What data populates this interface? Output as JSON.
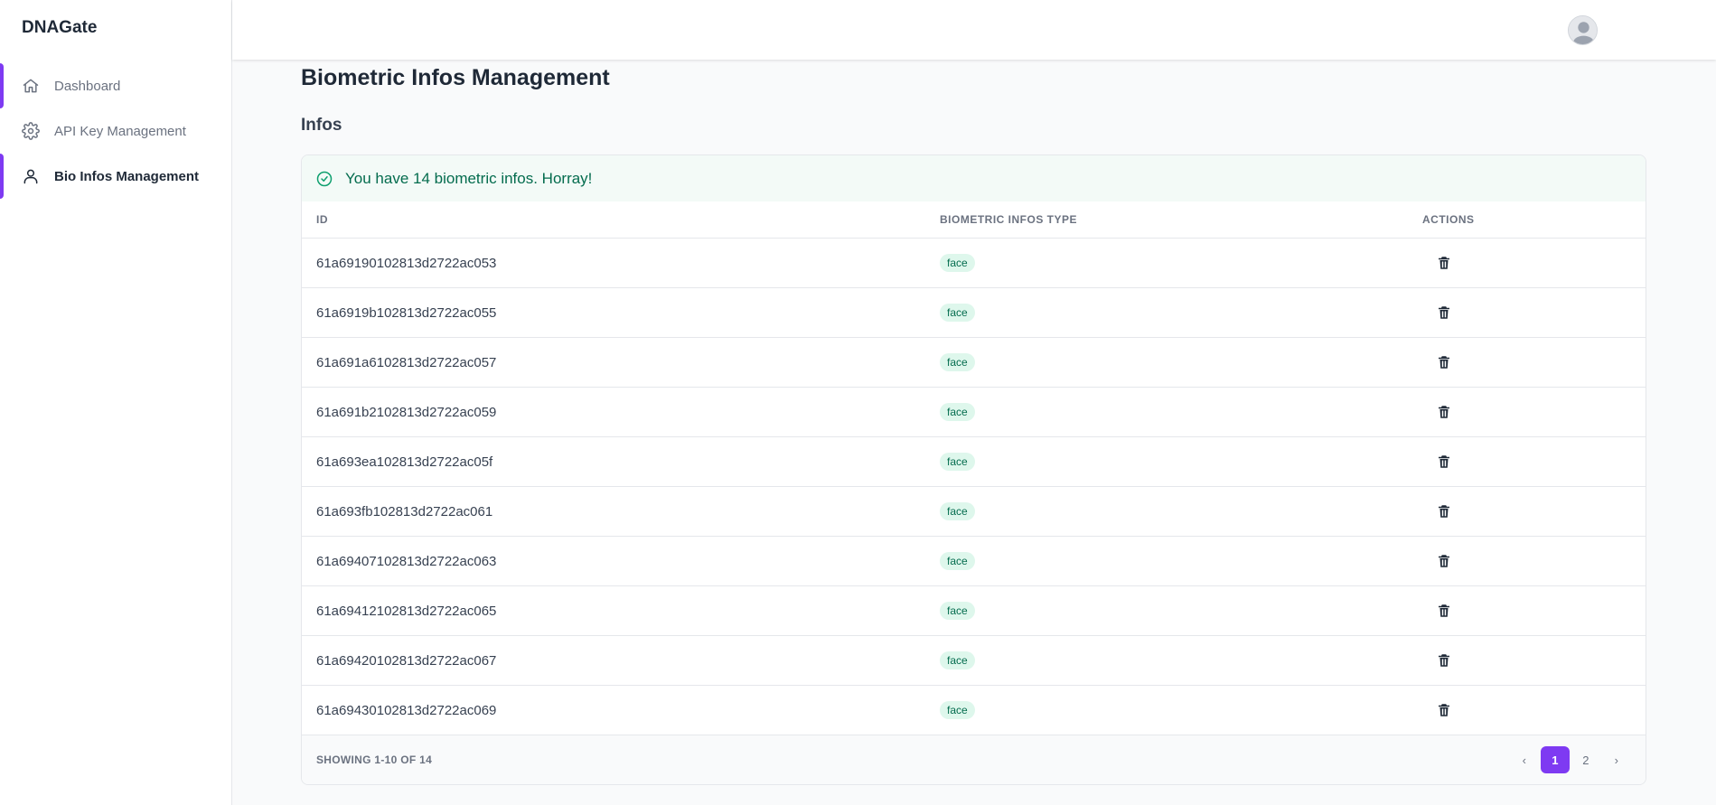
{
  "app": {
    "brand": "DNAGate"
  },
  "sidebar": {
    "items": [
      {
        "label": "Dashboard",
        "icon": "home-icon"
      },
      {
        "label": "API Key Management",
        "icon": "gear-icon"
      },
      {
        "label": "Bio Infos Management",
        "icon": "user-icon"
      }
    ]
  },
  "main": {
    "title": "Biometric Infos Management",
    "section": "Infos",
    "alert": "You have 14 biometric infos. Horray!"
  },
  "table": {
    "headers": {
      "id": "ID",
      "type": "BIOMETRIC INFOS TYPE",
      "actions": "ACTIONS"
    },
    "rows": [
      {
        "id": "61a69190102813d2722ac053",
        "type": "face"
      },
      {
        "id": "61a6919b102813d2722ac055",
        "type": "face"
      },
      {
        "id": "61a691a6102813d2722ac057",
        "type": "face"
      },
      {
        "id": "61a691b2102813d2722ac059",
        "type": "face"
      },
      {
        "id": "61a693ea102813d2722ac05f",
        "type": "face"
      },
      {
        "id": "61a693fb102813d2722ac061",
        "type": "face"
      },
      {
        "id": "61a69407102813d2722ac063",
        "type": "face"
      },
      {
        "id": "61a69412102813d2722ac065",
        "type": "face"
      },
      {
        "id": "61a69420102813d2722ac067",
        "type": "face"
      },
      {
        "id": "61a69430102813d2722ac069",
        "type": "face"
      }
    ],
    "footer": "SHOWING 1-10 OF 14",
    "pagination": {
      "prev": "‹",
      "pages": [
        "1",
        "2"
      ],
      "current": "1",
      "next": "›"
    }
  },
  "colors": {
    "accent": "#7e3af2",
    "success_bg": "#f3faf7",
    "success_text": "#046c4e",
    "badge_bg": "#def7ec"
  }
}
